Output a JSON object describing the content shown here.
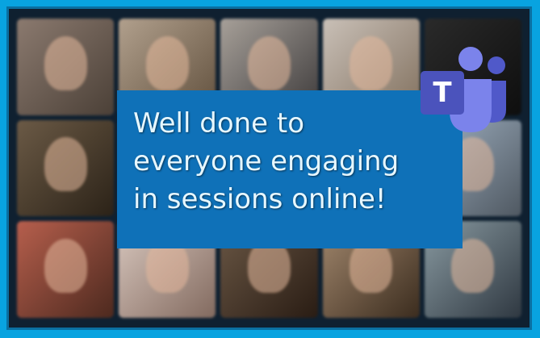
{
  "message": {
    "lines": [
      "Well done to",
      "everyone engaging",
      "in sessions online!"
    ]
  },
  "teams_logo": {
    "icon": "microsoft-teams-icon",
    "letter": "T",
    "colors": {
      "dark": "#4b53bc",
      "mid": "#5059c9",
      "light": "#7b83eb"
    }
  },
  "colors": {
    "background": "#08a3e0",
    "message_box": "#0f71b8",
    "message_text": "#e6f7ff"
  }
}
